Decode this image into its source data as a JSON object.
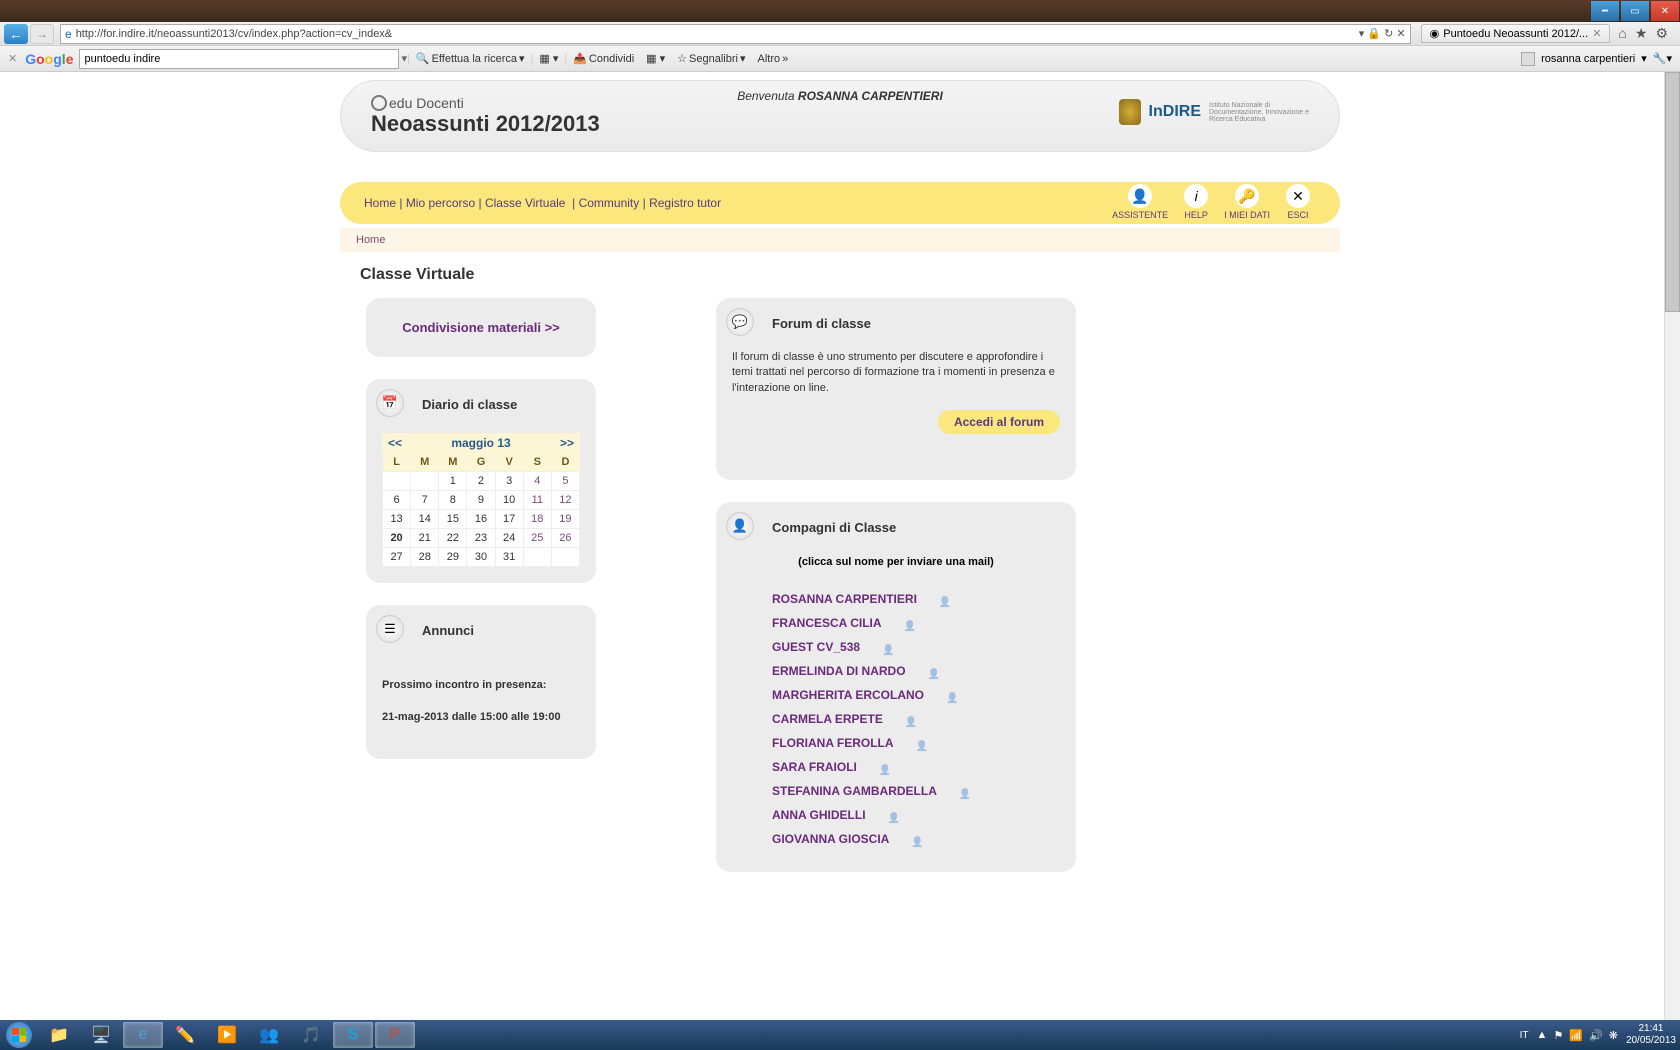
{
  "browser": {
    "url": "http://for.indire.it/neoassunti2013/cv/index.php?action=cv_index&",
    "tab_title": "Puntoedu Neoassunti 2012/..."
  },
  "google_toolbar": {
    "search_value": "puntoedu indire",
    "search_btn": "Effettua la ricerca",
    "share": "Condividi",
    "bookmarks": "Segnalibri",
    "more": "Altro",
    "user": "rosanna carpentieri"
  },
  "header": {
    "logo_top": "edu Docenti",
    "logo_title": "Neoassunti 2012/2013",
    "welcome_prefix": "Benvenuta ",
    "welcome_user": "ROSANNA CARPENTIERI",
    "indire": "InDIRE",
    "indire_sub": "Istituto Nazionale di Documentazione, Innovazione e Ricerca Educativa"
  },
  "nav": {
    "home": "Home",
    "percorso": "Mio percorso",
    "classe": "Classe Virtuale",
    "community": "Community",
    "registro": "Registro tutor",
    "assistente": "ASSISTENTE",
    "help": "HELP",
    "dati": "I MIEI DATI",
    "esci": "ESCI"
  },
  "breadcrumb": {
    "home": "Home"
  },
  "page": {
    "title": "Classe Virtuale"
  },
  "share": {
    "link": "Condivisione materiali >>"
  },
  "calendar": {
    "title": "Diario di classe",
    "prev": "<<",
    "next": ">>",
    "month": "maggio 13",
    "days": [
      "L",
      "M",
      "M",
      "G",
      "V",
      "S",
      "D"
    ],
    "weeks": [
      [
        "",
        "",
        "1",
        "2",
        "3",
        "4",
        "5"
      ],
      [
        "6",
        "7",
        "8",
        "9",
        "10",
        "11",
        "12"
      ],
      [
        "13",
        "14",
        "15",
        "16",
        "17",
        "18",
        "19"
      ],
      [
        "20",
        "21",
        "22",
        "23",
        "24",
        "25",
        "26"
      ],
      [
        "27",
        "28",
        "29",
        "30",
        "31",
        "",
        ""
      ]
    ],
    "today": "20"
  },
  "annunci": {
    "title": "Annunci",
    "line1": "Prossimo incontro in presenza:",
    "line2": "21-mag-2013 dalle 15:00 alle 19:00"
  },
  "forum": {
    "title": "Forum di classe",
    "desc": "Il forum di classe è uno strumento per discutere e approfondire i temi trattati nel percorso di formazione tra i momenti in presenza e l'interazione on line.",
    "button": "Accedi al forum"
  },
  "classmates": {
    "title": "Compagni di Classe",
    "hint": "(clicca sul nome per inviare una mail)",
    "list": [
      "ROSANNA CARPENTIERI",
      "FRANCESCA CILIA",
      "GUEST CV_538",
      "ERMELINDA DI NARDO",
      "MARGHERITA ERCOLANO",
      "CARMELA ERPETE",
      "FLORIANA FEROLLA",
      "SARA FRAIOLI",
      "STEFANINA GAMBARDELLA",
      "ANNA GHIDELLI",
      "GIOVANNA GIOSCIA"
    ]
  },
  "taskbar": {
    "lang": "IT",
    "time": "21:41",
    "date": "20/05/2013"
  }
}
